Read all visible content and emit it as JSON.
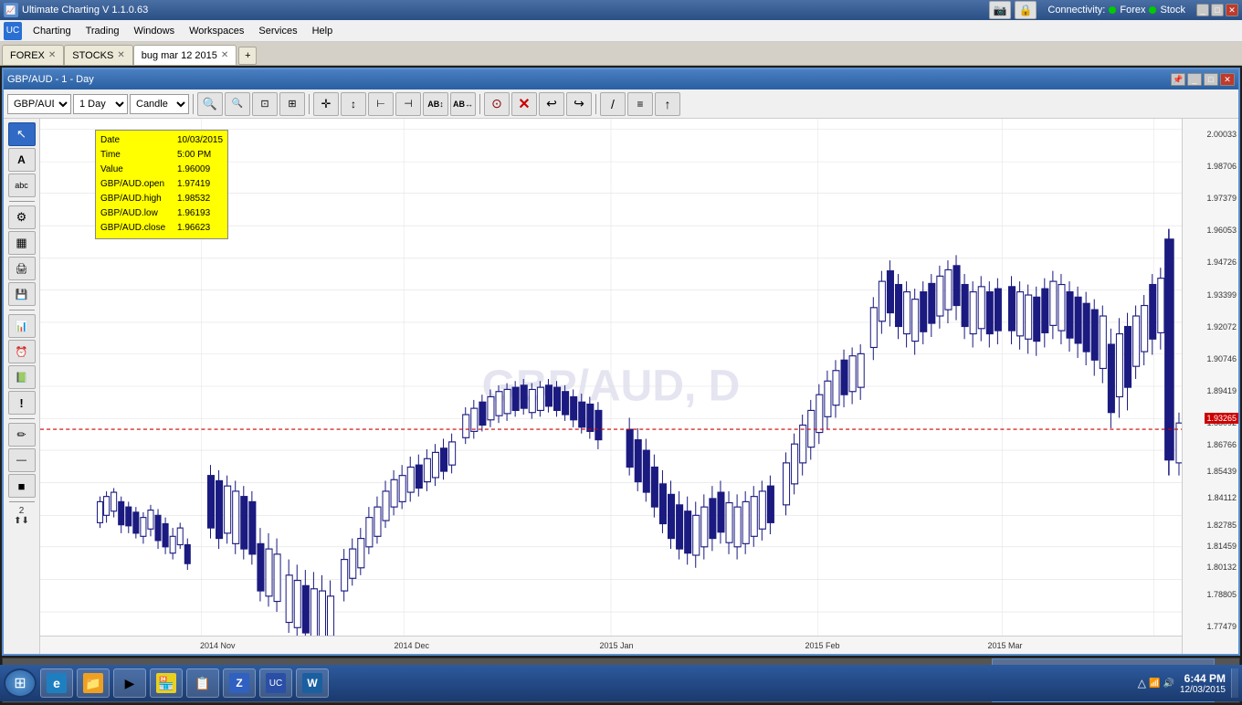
{
  "app": {
    "title": "Ultimate Charting V 1.1.0.63",
    "icon": "📈"
  },
  "menu": {
    "items": [
      "Charting",
      "Trading",
      "Windows",
      "Workspaces",
      "Services",
      "Help"
    ]
  },
  "tabs": [
    {
      "label": "FOREX",
      "active": false
    },
    {
      "label": "STOCKS",
      "active": false
    },
    {
      "label": "bug mar 12 2015",
      "active": true
    }
  ],
  "chart_window": {
    "title": "GBP/AUD - 1 - Day",
    "symbol": "GBP/AUD",
    "period": "1 Day",
    "chart_type": "Candle"
  },
  "tooltip": {
    "date_label": "Date",
    "date_value": "10/03/2015",
    "time_label": "Time",
    "time_value": "5:00 PM",
    "value_label": "Value",
    "value_value": "1.96009",
    "open_label": "GBP/AUD.open",
    "open_value": "1.97419",
    "high_label": "GBP/AUD.high",
    "high_value": "1.98532",
    "low_label": "GBP/AUD.low",
    "low_value": "1.96193",
    "close_label": "GBP/AUD.close",
    "close_value": "1.96623"
  },
  "price_levels": [
    {
      "price": "2.00033",
      "y_pct": 2
    },
    {
      "price": "1.98706",
      "y_pct": 8
    },
    {
      "price": "1.97379",
      "y_pct": 14
    },
    {
      "price": "1.96053",
      "y_pct": 20
    },
    {
      "price": "1.94726",
      "y_pct": 26
    },
    {
      "price": "1.93399",
      "y_pct": 32
    },
    {
      "price": "1.93265",
      "y_pct": 34
    },
    {
      "price": "1.92072",
      "y_pct": 38
    },
    {
      "price": "1.90746",
      "y_pct": 44
    },
    {
      "price": "1.89419",
      "y_pct": 50
    },
    {
      "price": "1.88092",
      "y_pct": 56
    },
    {
      "price": "1.86766",
      "y_pct": 60
    },
    {
      "price": "1.85439",
      "y_pct": 65
    },
    {
      "price": "1.84112",
      "y_pct": 70
    },
    {
      "price": "1.82785",
      "y_pct": 75
    },
    {
      "price": "1.81459",
      "y_pct": 79
    },
    {
      "price": "1.80132",
      "y_pct": 83
    },
    {
      "price": "1.78805",
      "y_pct": 88
    },
    {
      "price": "1.77479",
      "y_pct": 94
    }
  ],
  "time_labels": [
    {
      "label": "2014 Nov",
      "x_pct": 14
    },
    {
      "label": "2014 Dec",
      "x_pct": 32
    },
    {
      "label": "2015 Jan",
      "x_pct": 50
    },
    {
      "label": "2015 Feb",
      "x_pct": 68
    },
    {
      "label": "2015 Mar",
      "x_pct": 84
    }
  ],
  "current_price": "1.93265",
  "watermark": "GBP/AUD, D",
  "connectivity": {
    "label": "Connectivity:",
    "forex_label": "Forex",
    "stock_label": "Stock"
  },
  "taskbar": {
    "time": "6:44 PM",
    "date": "12/03/2015"
  },
  "toolbar_buttons": [
    {
      "name": "zoom-in",
      "symbol": "🔍+",
      "label": "+"
    },
    {
      "name": "zoom-out",
      "symbol": "🔍-",
      "label": "-"
    },
    {
      "name": "zoom-fit",
      "symbol": "⊡",
      "label": "fit"
    },
    {
      "name": "zoom-reset",
      "symbol": "⊞",
      "label": "reset"
    },
    {
      "name": "crosshair",
      "symbol": "+",
      "label": "crosshair"
    },
    {
      "name": "line-tool",
      "symbol": "↕",
      "label": "line"
    },
    {
      "name": "tool3",
      "symbol": "⊢",
      "label": "t3"
    },
    {
      "name": "tool4",
      "symbol": "⊣",
      "label": "t4"
    },
    {
      "name": "text-tool",
      "symbol": "AB",
      "label": "text"
    },
    {
      "name": "text-tool2",
      "symbol": "AB",
      "label": "text2"
    },
    {
      "name": "magnet",
      "symbol": "⊙",
      "label": "magnet"
    },
    {
      "name": "delete",
      "symbol": "✕",
      "label": "delete"
    },
    {
      "name": "undo",
      "symbol": "↩",
      "label": "undo"
    },
    {
      "name": "redo",
      "symbol": "↪",
      "label": "redo"
    },
    {
      "name": "draw-line",
      "symbol": "/",
      "label": "draw"
    },
    {
      "name": "hline",
      "symbol": "≡",
      "label": "hline"
    },
    {
      "name": "arrow",
      "symbol": "↑",
      "label": "arrow"
    }
  ],
  "left_tools": [
    {
      "name": "pointer",
      "symbol": "↖",
      "label": "pointer",
      "active": true
    },
    {
      "name": "text",
      "symbol": "A",
      "label": "text",
      "active": false
    },
    {
      "name": "abc",
      "symbol": "abc",
      "label": "abc",
      "active": false
    },
    {
      "name": "settings",
      "symbol": "⚙",
      "label": "settings",
      "active": false
    },
    {
      "name": "layers",
      "symbol": "▦",
      "label": "layers",
      "active": false
    },
    {
      "name": "print",
      "symbol": "🖨",
      "label": "print",
      "active": false
    },
    {
      "name": "save",
      "symbol": "💾",
      "label": "save",
      "active": false
    },
    {
      "name": "chart-type",
      "symbol": "📊",
      "label": "chart-type",
      "active": false
    },
    {
      "name": "alarm",
      "symbol": "⏰",
      "label": "alarm",
      "active": false
    },
    {
      "name": "excel",
      "symbol": "📗",
      "label": "excel",
      "active": false
    },
    {
      "name": "alert",
      "symbol": "!",
      "label": "alert",
      "active": false
    },
    {
      "name": "pencil",
      "symbol": "✏",
      "label": "pencil",
      "active": false
    },
    {
      "name": "line-width",
      "symbol": "—",
      "label": "line-width",
      "active": false
    },
    {
      "name": "fill",
      "symbol": "■",
      "label": "fill",
      "active": false
    },
    {
      "name": "number",
      "symbol": "2",
      "label": "number",
      "active": false
    }
  ]
}
